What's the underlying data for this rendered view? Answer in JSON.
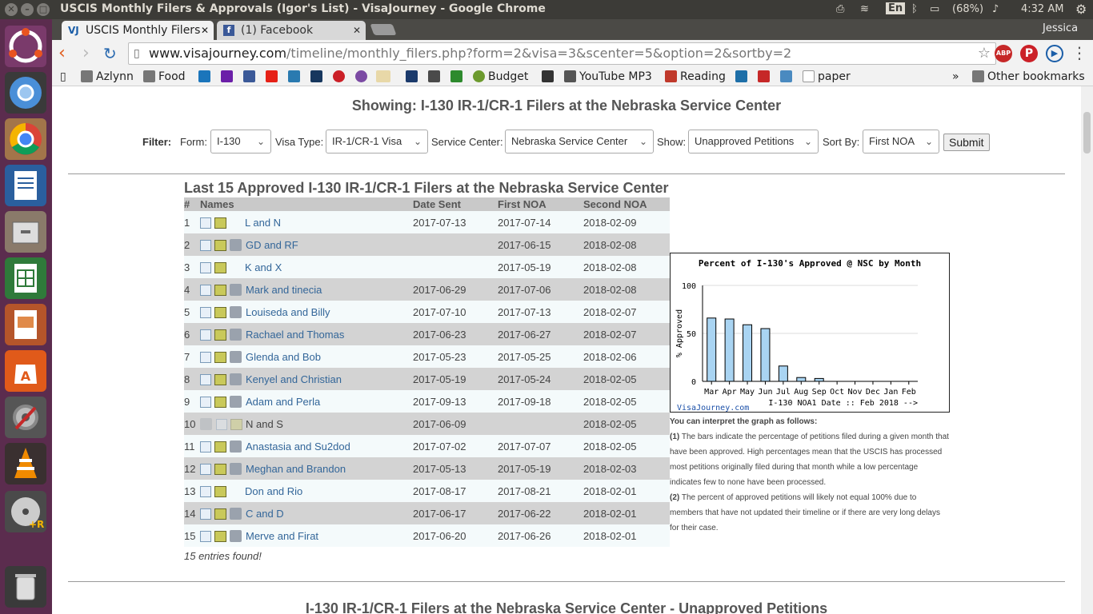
{
  "window": {
    "title": "USCIS Monthly Filers & Approvals (Igor's List) - VisaJourney - Google Chrome"
  },
  "tray": {
    "battery": "(68%)",
    "time": "4:32 AM",
    "lang": "En",
    "user": "Jessica"
  },
  "tabs": [
    {
      "label": "USCIS Monthly Filers",
      "icon": "VJ"
    },
    {
      "label": "(1) Facebook",
      "icon": "f"
    }
  ],
  "address": {
    "host": "www.visajourney.com",
    "path": "/timeline/monthly_filers.php?form=2&visa=3&scenter=5&option=2&sortby=2"
  },
  "bookmarks": [
    {
      "label": "Azlynn",
      "type": "folder"
    },
    {
      "label": "Food",
      "type": "folder"
    },
    {
      "label": "",
      "type": "site",
      "color": "#1b75bb"
    },
    {
      "label": "",
      "type": "site",
      "color": "#6b1fa8"
    },
    {
      "label": "",
      "type": "site",
      "color": "#3b5998"
    },
    {
      "label": "",
      "type": "site",
      "color": "#e62117"
    },
    {
      "label": "",
      "type": "site",
      "color": "#2a7ab0"
    },
    {
      "label": "",
      "type": "site",
      "color": "#17375e"
    },
    {
      "label": "",
      "type": "site",
      "color": "#cb2027"
    },
    {
      "label": "",
      "type": "site",
      "color": "#7b4aa3"
    },
    {
      "label": "",
      "type": "site",
      "color": "#e8d8a8"
    },
    {
      "label": "",
      "type": "site",
      "color": "#1b3a6b"
    },
    {
      "label": "",
      "type": "site",
      "color": "#4a4a4a"
    },
    {
      "label": "",
      "type": "site",
      "color": "#2d8a2d"
    },
    {
      "label": "Budget",
      "type": "site",
      "color": "#6c9a2e"
    },
    {
      "label": "",
      "type": "site",
      "color": "#333333"
    },
    {
      "label": "YouTube MP3",
      "type": "site",
      "color": "#555555"
    },
    {
      "label": "Reading",
      "type": "site",
      "color": "#c0392b"
    },
    {
      "label": "",
      "type": "site",
      "color": "#1e6fa8"
    },
    {
      "label": "",
      "type": "site",
      "color": "#c62828"
    },
    {
      "label": "",
      "type": "site",
      "color": "#4a8ac0"
    },
    {
      "label": "paper",
      "type": "page"
    }
  ],
  "bookmarks_more": "»",
  "other_bookmarks": "Other bookmarks",
  "page": {
    "showing": "Showing: I-130 IR-1/CR-1 Filers at the Nebraska Service Center",
    "filter": {
      "label": "Filter:",
      "form_label": "Form:",
      "form_value": "I-130",
      "visa_label": "Visa Type:",
      "visa_value": "IR-1/CR-1 Visa",
      "center_label": "Service Center:",
      "center_value": "Nebraska Service Center",
      "show_label": "Show:",
      "show_value": "Unapproved Petitions",
      "sort_label": "Sort By:",
      "sort_value": "First NOA",
      "submit": "Submit"
    },
    "section_title": "Last 15 Approved I-130 IR-1/CR-1 Filers at the Nebraska Service Center",
    "columns": [
      "#",
      "Names",
      "Date Sent",
      "First NOA",
      "Second NOA"
    ],
    "rows": [
      {
        "n": "1",
        "name": "L and N",
        "sent": "2017-07-13",
        "first": "2017-07-14",
        "second": "2018-02-09",
        "avatar": false,
        "linked": true
      },
      {
        "n": "2",
        "name": "GD and RF",
        "sent": "",
        "first": "2017-06-15",
        "second": "2018-02-08",
        "avatar": true,
        "linked": true
      },
      {
        "n": "3",
        "name": "K and X",
        "sent": "",
        "first": "2017-05-19",
        "second": "2018-02-08",
        "avatar": false,
        "linked": true
      },
      {
        "n": "4",
        "name": "Mark and tinecia",
        "sent": "2017-06-29",
        "first": "2017-07-06",
        "second": "2018-02-08",
        "avatar": true,
        "linked": true
      },
      {
        "n": "5",
        "name": "Louiseda and Billy",
        "sent": "2017-07-10",
        "first": "2017-07-13",
        "second": "2018-02-07",
        "avatar": true,
        "linked": true
      },
      {
        "n": "6",
        "name": "Rachael and Thomas",
        "sent": "2017-06-23",
        "first": "2017-06-27",
        "second": "2018-02-07",
        "avatar": true,
        "linked": true
      },
      {
        "n": "7",
        "name": "Glenda and Bob",
        "sent": "2017-05-23",
        "first": "2017-05-25",
        "second": "2018-02-06",
        "avatar": true,
        "linked": true
      },
      {
        "n": "8",
        "name": "Kenyel and Christian",
        "sent": "2017-05-19",
        "first": "2017-05-24",
        "second": "2018-02-05",
        "avatar": true,
        "linked": true
      },
      {
        "n": "9",
        "name": "Adam and Perla",
        "sent": "2017-09-13",
        "first": "2017-09-18",
        "second": "2018-02-05",
        "avatar": true,
        "linked": true
      },
      {
        "n": "10",
        "name": "N and S",
        "sent": "2017-06-09",
        "first": "",
        "second": "2018-02-05",
        "avatar": false,
        "linked": false
      },
      {
        "n": "11",
        "name": "Anastasia and Su2dod",
        "sent": "2017-07-02",
        "first": "2017-07-07",
        "second": "2018-02-05",
        "avatar": true,
        "linked": true
      },
      {
        "n": "12",
        "name": "Meghan and Brandon",
        "sent": "2017-05-13",
        "first": "2017-05-19",
        "second": "2018-02-03",
        "avatar": true,
        "linked": true
      },
      {
        "n": "13",
        "name": "Don and Rio",
        "sent": "2017-08-17",
        "first": "2017-08-21",
        "second": "2018-02-01",
        "avatar": false,
        "linked": true
      },
      {
        "n": "14",
        "name": "C and D",
        "sent": "2017-06-17",
        "first": "2017-06-22",
        "second": "2018-02-01",
        "avatar": true,
        "linked": true
      },
      {
        "n": "15",
        "name": "Merve and Firat",
        "sent": "2017-06-20",
        "first": "2017-06-26",
        "second": "2018-02-01",
        "avatar": true,
        "linked": true
      }
    ],
    "found": "15 entries found!",
    "interp_heading": "You can interpret the graph as follows:",
    "interp_1_num": "(1)",
    "interp_1": "The bars indicate the percentage of petitions filed during a given month that have been approved. High percentages mean that the USCIS has processed most petitions originally filed during that month while a low percentage indicates few to none have been processed.",
    "interp_2_num": "(2)",
    "interp_2": "The percent of approved petitions will likely not equal 100% due to members that have not updated their timeline or if there are very long delays for their case.",
    "bottom_title": "I-130 IR-1/CR-1 Filers at the Nebraska Service Center - Unapproved Petitions"
  },
  "chart_data": {
    "type": "bar",
    "title": "Percent of I-130's Approved @ NSC by Month",
    "ylabel": "% Approved",
    "xlabel": "I-130 NOA1 Date :: Feb 2018 -->",
    "credit": "VisaJourney.com",
    "categories": [
      "Mar",
      "Apr",
      "May",
      "Jun",
      "Jul",
      "Aug",
      "Sep",
      "Oct",
      "Nov",
      "Dec",
      "Jan",
      "Feb"
    ],
    "values": [
      66,
      65,
      59,
      55,
      16,
      4,
      3,
      0,
      0,
      0,
      0,
      0
    ],
    "yticks": [
      "0",
      "50",
      "100"
    ],
    "ylim": [
      0,
      100
    ],
    "bar_color": "#a9d4f2"
  }
}
